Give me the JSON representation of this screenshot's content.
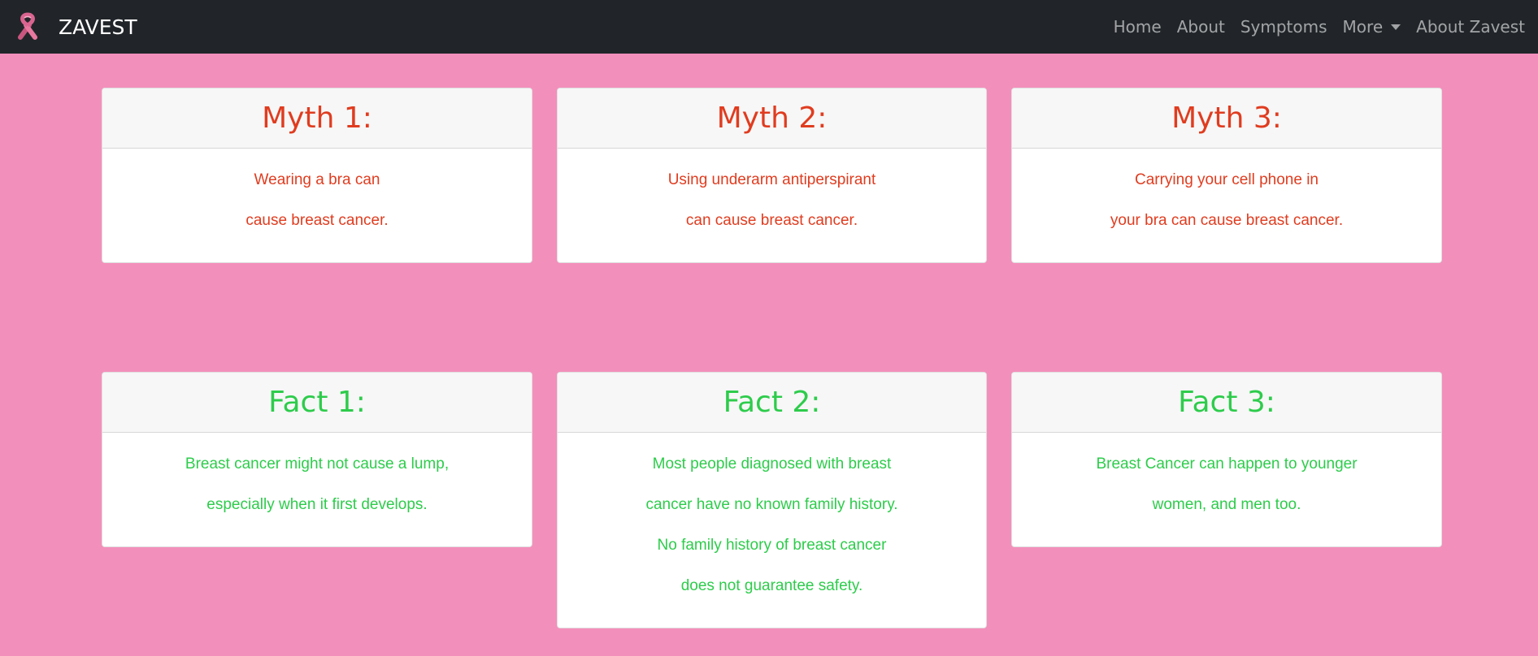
{
  "navbar": {
    "brand": "ZAVEST",
    "logo_icon": "pink-ribbon-icon",
    "links": [
      {
        "label": "Home"
      },
      {
        "label": "About"
      },
      {
        "label": "Symptoms"
      },
      {
        "label": "More",
        "dropdown": true
      },
      {
        "label": "About Zavest"
      }
    ]
  },
  "colors": {
    "background": "#f38fbb",
    "navbar": "#212529",
    "myth": "#e03c1f",
    "fact": "#2dcc4b"
  },
  "myths": [
    {
      "title": "Myth 1:",
      "lines": [
        "Wearing a bra can",
        "cause breast cancer."
      ]
    },
    {
      "title": "Myth 2:",
      "lines": [
        "Using underarm antiperspirant",
        "can cause breast cancer."
      ]
    },
    {
      "title": "Myth 3:",
      "lines": [
        "Carrying your cell phone in",
        "your bra can cause breast cancer."
      ]
    }
  ],
  "facts": [
    {
      "title": "Fact 1:",
      "lines": [
        "Breast cancer might not cause a lump,",
        "especially when it first develops."
      ]
    },
    {
      "title": "Fact 2:",
      "lines": [
        "Most people diagnosed with breast",
        "cancer have no known family history.",
        "No family history of breast cancer",
        "does not guarantee safety."
      ]
    },
    {
      "title": "Fact 3:",
      "lines": [
        "Breast Cancer can happen to younger",
        "women, and men too."
      ]
    }
  ]
}
